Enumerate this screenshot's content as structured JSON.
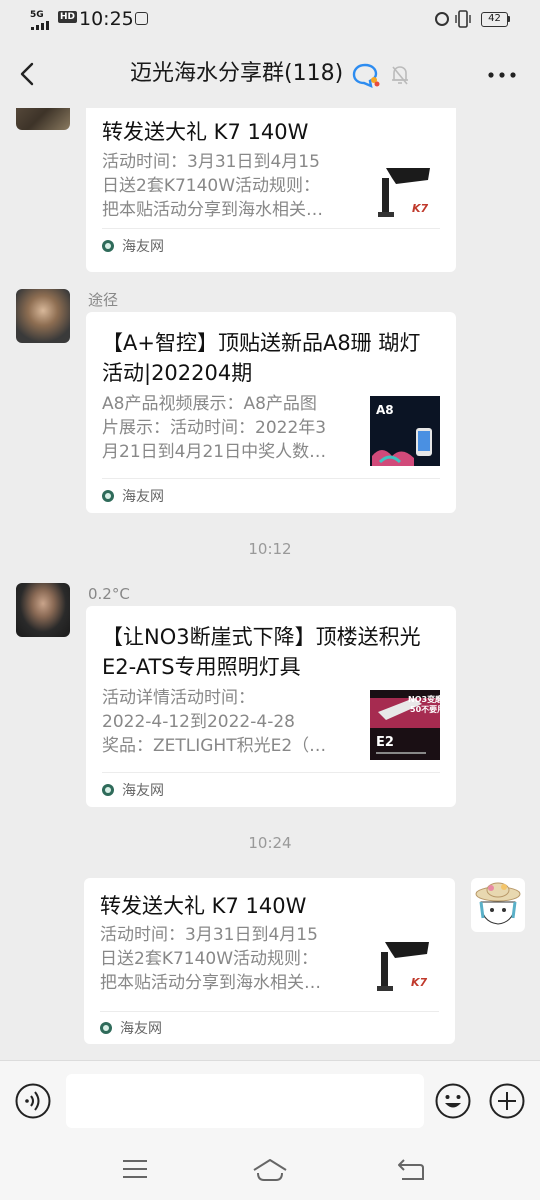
{
  "status_bar": {
    "network": "5G",
    "hd": "HD",
    "time": "10:25",
    "battery": "42"
  },
  "header": {
    "title": "迈光海水分享群(118)"
  },
  "messages": [
    {
      "title": "转发送大礼 K7 140W",
      "description": "活动时间：3月31日到4月15\n日送2套K7140W活动规则：\n把本贴活动分享到海水相关…",
      "source": "海友网"
    },
    {
      "sender": "途径",
      "title": "【A+智控】顶贴送新品A8珊 瑚灯活动|202204期",
      "description": "A8产品视频展示：A8产品图\n片展示：活动时间：2022年3\n月21日到4月21日中奖人数…",
      "source": "海友网",
      "thumb_text": "A8"
    },
    {
      "sender": "0.2°C",
      "title": "【让NO3断崖式下降】顶楼送积光E2-ATS专用照明灯具",
      "description": "活动详情活动时间：\n2022-4-12到2022-4-28\n奖品：ZETLIGHT积光E2（…",
      "source": "海友网",
      "thumb_text": "E2",
      "thumb_sub": "NO3变磨\n50不要用"
    },
    {
      "title": "转发送大礼 K7 140W",
      "description": "活动时间：3月31日到4月15\n日送2套K7140W活动规则：\n把本贴活动分享到海水相关…",
      "source": "海友网"
    }
  ],
  "timestamps": [
    "10:12",
    "10:24"
  ],
  "input": {
    "placeholder": ""
  },
  "icons": [
    "back-icon",
    "qq-icon",
    "mute-icon",
    "more-icon",
    "voice-icon",
    "emoji-icon",
    "plus-icon",
    "menu-icon",
    "home-icon",
    "back-nav-icon"
  ]
}
